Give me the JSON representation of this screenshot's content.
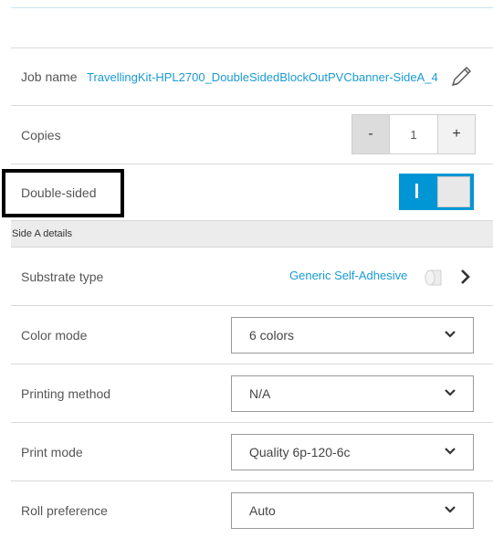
{
  "job": {
    "label": "Job name",
    "value": "TravellingKit-HPL2700_DoubleSidedBlockOutPVCbanner-SideA_4"
  },
  "copies": {
    "label": "Copies",
    "minus": "-",
    "value": "1",
    "plus": "+"
  },
  "double_sided": {
    "label": "Double-sided",
    "toggle_on_mark": "I",
    "enabled": true
  },
  "section": {
    "title": "Side A details"
  },
  "substrate": {
    "label": "Substrate type",
    "value": "Generic Self-Adhesive"
  },
  "color_mode": {
    "label": "Color mode",
    "selected": "6 colors"
  },
  "printing_method": {
    "label": "Printing method",
    "selected": "N/A"
  },
  "print_mode": {
    "label": "Print mode",
    "selected": "Quality 6p-120-6c"
  },
  "roll_preference": {
    "label": "Roll preference",
    "selected": "Auto"
  },
  "colors": {
    "accent": "#0096d6",
    "link": "#1a9bd6",
    "section_bg": "#ececec"
  }
}
